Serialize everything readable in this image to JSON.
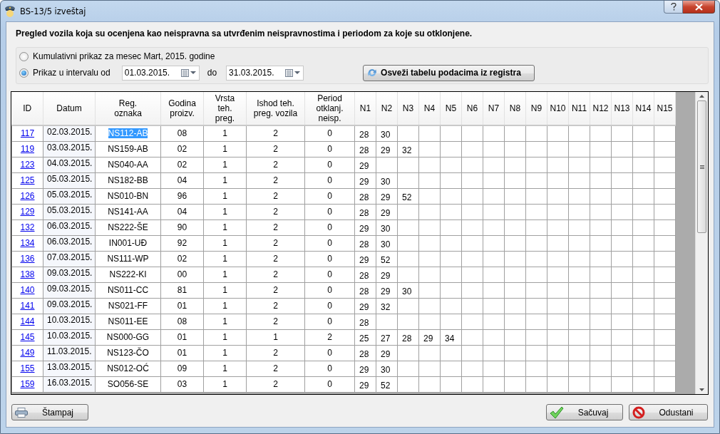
{
  "window": {
    "title": "BS-13/5 izveštaj"
  },
  "heading": "Pregled vozila koja su ocenjena kao neispravna sa utvrđenim neispravnostima i periodom za koje su otklonjene.",
  "view_options": [
    {
      "kind": "month",
      "label": "Kumulativni prikaz za mesec Mart, 2015. godine",
      "selected": false
    },
    {
      "kind": "interval",
      "label": "Prikaz u intervalu od",
      "selected": true,
      "from": "01.03.2015.",
      "to_label": "do",
      "to": "31.03.2015."
    }
  ],
  "refresh_button": "Osveži tabelu podacima iz registra",
  "table": {
    "columns": [
      "ID",
      "Datum",
      "Reg.\noznaka",
      "Godina\nproizv.",
      "Vrsta\nteh.\npreg.",
      "Ishod teh.\npreg. vozila",
      "Period\notklanj.\nneisp.",
      "N1",
      "N2",
      "N3",
      "N4",
      "N5",
      "N6",
      "N7",
      "N8",
      "N9",
      "N10",
      "N11",
      "N12",
      "N13",
      "N14",
      "N15"
    ],
    "rows": [
      {
        "id": "117",
        "date": "02.03.2015.",
        "reg": "NS112-AB",
        "year": "08",
        "type": "1",
        "outcome": "2",
        "period": "0",
        "n": [
          "28",
          "30"
        ],
        "selected": true
      },
      {
        "id": "119",
        "date": "03.03.2015.",
        "reg": "NS159-AB",
        "year": "02",
        "type": "1",
        "outcome": "2",
        "period": "0",
        "n": [
          "28",
          "29",
          "32"
        ],
        "selected": false
      },
      {
        "id": "123",
        "date": "04.03.2015.",
        "reg": "NS040-AA",
        "year": "02",
        "type": "1",
        "outcome": "2",
        "period": "0",
        "n": [
          "29"
        ],
        "selected": false
      },
      {
        "id": "125",
        "date": "05.03.2015.",
        "reg": "NS182-BB",
        "year": "04",
        "type": "1",
        "outcome": "2",
        "period": "0",
        "n": [
          "29",
          "30"
        ],
        "selected": false
      },
      {
        "id": "126",
        "date": "05.03.2015.",
        "reg": "NS010-BN",
        "year": "96",
        "type": "1",
        "outcome": "2",
        "period": "0",
        "n": [
          "28",
          "29",
          "52"
        ],
        "selected": false
      },
      {
        "id": "129",
        "date": "05.03.2015.",
        "reg": "NS141-AA",
        "year": "04",
        "type": "1",
        "outcome": "2",
        "period": "0",
        "n": [
          "28",
          "29"
        ],
        "selected": false
      },
      {
        "id": "132",
        "date": "06.03.2015.",
        "reg": "NS222-ŠE",
        "year": "90",
        "type": "1",
        "outcome": "2",
        "period": "0",
        "n": [
          "29",
          "30"
        ],
        "selected": false
      },
      {
        "id": "134",
        "date": "06.03.2015.",
        "reg": "IN001-UĐ",
        "year": "92",
        "type": "1",
        "outcome": "2",
        "period": "0",
        "n": [
          "28",
          "30"
        ],
        "selected": false
      },
      {
        "id": "136",
        "date": "07.03.2015.",
        "reg": "NS111-WP",
        "year": "02",
        "type": "1",
        "outcome": "2",
        "period": "0",
        "n": [
          "29",
          "52"
        ],
        "selected": false
      },
      {
        "id": "138",
        "date": "09.03.2015.",
        "reg": "NS222-KI",
        "year": "00",
        "type": "1",
        "outcome": "2",
        "period": "0",
        "n": [
          "28",
          "29"
        ],
        "selected": false
      },
      {
        "id": "140",
        "date": "09.03.2015.",
        "reg": "NS011-CC",
        "year": "81",
        "type": "1",
        "outcome": "2",
        "period": "0",
        "n": [
          "28",
          "29",
          "30"
        ],
        "selected": false
      },
      {
        "id": "141",
        "date": "09.03.2015.",
        "reg": "NS021-FF",
        "year": "01",
        "type": "1",
        "outcome": "2",
        "period": "0",
        "n": [
          "29",
          "32"
        ],
        "selected": false
      },
      {
        "id": "144",
        "date": "10.03.2015.",
        "reg": "NS011-EE",
        "year": "08",
        "type": "1",
        "outcome": "2",
        "period": "0",
        "n": [
          "28"
        ],
        "selected": false
      },
      {
        "id": "145",
        "date": "10.03.2015.",
        "reg": "NS000-GG",
        "year": "01",
        "type": "1",
        "outcome": "1",
        "period": "2",
        "n": [
          "25",
          "27",
          "28",
          "29",
          "34"
        ],
        "selected": false
      },
      {
        "id": "149",
        "date": "11.03.2015.",
        "reg": "NS123-ČO",
        "year": "01",
        "type": "1",
        "outcome": "2",
        "period": "0",
        "n": [
          "28",
          "29"
        ],
        "selected": false
      },
      {
        "id": "155",
        "date": "13.03.2015.",
        "reg": "NS012-OĆ",
        "year": "09",
        "type": "1",
        "outcome": "2",
        "period": "0",
        "n": [
          "29",
          "30"
        ],
        "selected": false
      },
      {
        "id": "159",
        "date": "16.03.2015.",
        "reg": "SO056-SE",
        "year": "03",
        "type": "1",
        "outcome": "2",
        "period": "0",
        "n": [
          "29",
          "52"
        ],
        "selected": false
      }
    ]
  },
  "buttons": {
    "print": "Štampaj",
    "save": "Sačuvaj",
    "cancel": "Odustani"
  }
}
